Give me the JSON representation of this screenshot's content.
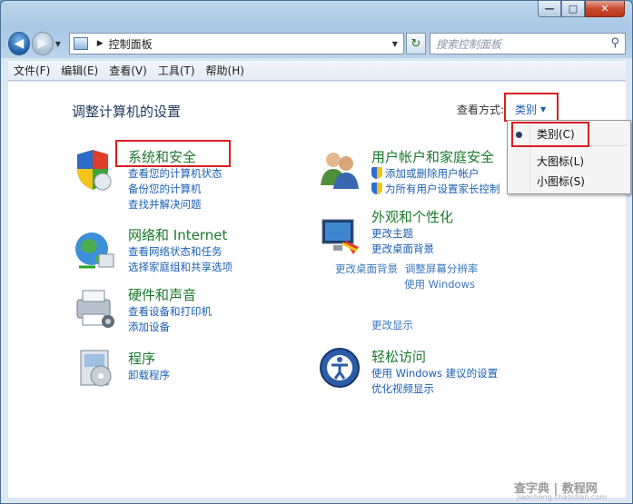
{
  "window": {
    "caption_buttons": {
      "minimize": "—",
      "maximize": "□",
      "close": "✕"
    }
  },
  "navbar": {
    "breadcrumb": "控制面板",
    "search_placeholder": "搜索控制面板"
  },
  "menu": [
    "文件(F)",
    "编辑(E)",
    "查看(V)",
    "工具(T)",
    "帮助(H)"
  ],
  "content": {
    "title": "调整计算机的设置",
    "view_by_label": "查看方式:",
    "view_by_value": "类别"
  },
  "categories": {
    "system": {
      "title": "系统和安全",
      "links": [
        "查看您的计算机状态",
        "备份您的计算机",
        "查找并解决问题"
      ]
    },
    "network": {
      "title": "网络和 Internet",
      "links": [
        "查看网络状态和任务",
        "选择家庭组和共享选项"
      ]
    },
    "hardware": {
      "title": "硬件和声音",
      "links": [
        "查看设备和打印机",
        "添加设备"
      ]
    },
    "programs": {
      "title": "程序",
      "links": [
        "卸载程序"
      ]
    },
    "users": {
      "title": "用户帐户和家庭安全",
      "links": [
        "添加或删除用户帐户",
        "为所有用户设置家长控制"
      ]
    },
    "appearance": {
      "title": "外观和个性化",
      "links": [
        "更改主题",
        "更改桌面背景",
        "更改桌面背景",
        "调整屏幕分辨率",
        "使用 Windows",
        "更改显示"
      ]
    },
    "ease": {
      "title": "轻松访问",
      "links": [
        "使用 Windows 建议的设置",
        "优化视频显示"
      ]
    }
  },
  "dropdown": {
    "items": [
      "类别(C)",
      "大图标(L)",
      "小图标(S)"
    ],
    "selected": "类别(C)"
  },
  "watermark": {
    "main": "查字典 | 教程网",
    "sub": "jiaocheng.chazidian.com"
  },
  "colors": {
    "accent_link": "#1a5fb4",
    "category_title": "#1b7a2b",
    "highlight_box": "#d81e1e"
  }
}
